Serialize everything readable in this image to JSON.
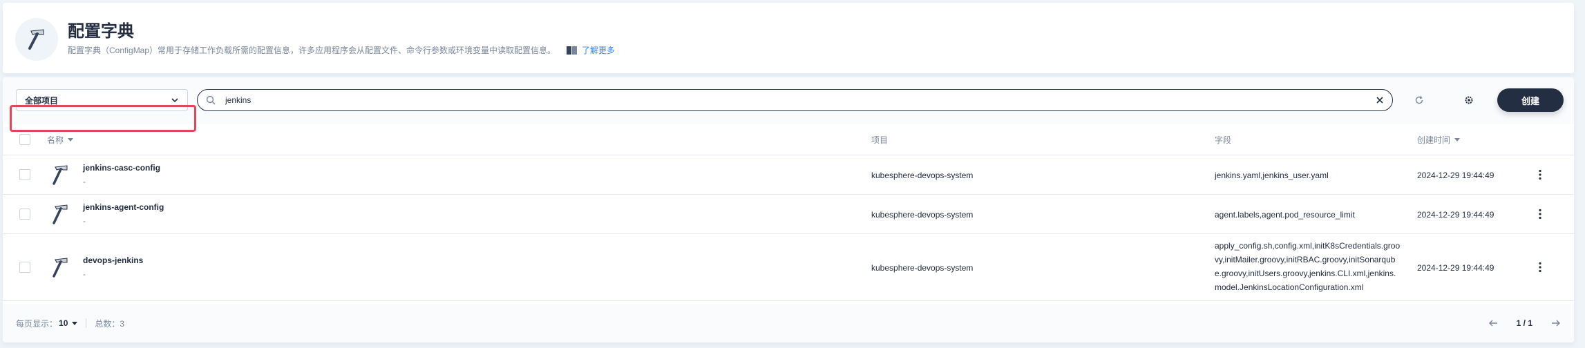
{
  "banner": {
    "title": "配置字典",
    "description": "配置字典（ConfigMap）常用于存储工作负载所需的配置信息，许多应用程序会从配置文件、命令行参数或环境变量中读取配置信息。",
    "learn_more": "了解更多",
    "icon": "hammer-icon"
  },
  "toolbar": {
    "project_select": "全部项目",
    "search_value": "jenkins",
    "create_label": "创建",
    "refresh_icon": "refresh-icon",
    "settings_icon": "gear-icon"
  },
  "table": {
    "headers": {
      "name": "名称",
      "project": "项目",
      "fields": "字段",
      "created": "创建时间"
    },
    "rows": [
      {
        "name": "jenkins-casc-config",
        "description": "-",
        "project": "kubesphere-devops-system",
        "fields": "jenkins.yaml,jenkins_user.yaml",
        "created": "2024-12-29 19:44:49"
      },
      {
        "name": "jenkins-agent-config",
        "description": "-",
        "project": "kubesphere-devops-system",
        "fields": "agent.labels,agent.pod_resource_limit",
        "created": "2024-12-29 19:44:49"
      },
      {
        "name": "devops-jenkins",
        "description": "-",
        "project": "kubesphere-devops-system",
        "fields": "apply_config.sh,config.xml,initK8sCredentials.groovy,initMailer.groovy,initRBAC.groovy,initSonarqube.groovy,initUsers.groovy,jenkins.CLI.xml,jenkins.model.JenkinsLocationConfiguration.xml",
        "created": "2024-12-29 19:44:49"
      }
    ]
  },
  "footer": {
    "per_page_label": "每页显示：",
    "per_page_value": "10",
    "total": "总数：3",
    "page_indicator": "1 / 1"
  },
  "colors": {
    "primary_dark": "#242e42",
    "muted": "#79879c",
    "link": "#3385ff",
    "highlight": "#e0475a"
  }
}
